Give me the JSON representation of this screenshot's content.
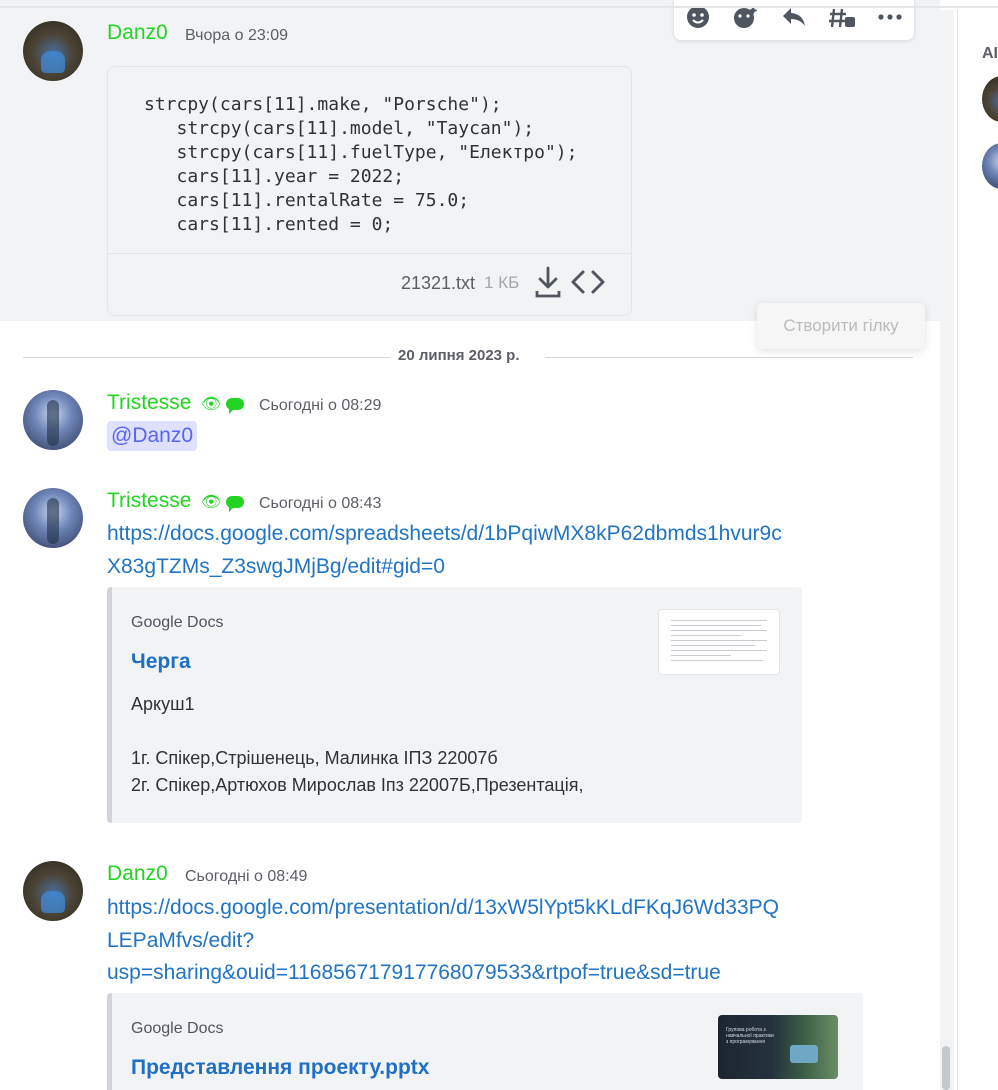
{
  "messages": [
    {
      "user": "Danz0",
      "time": "Вчора о 23:09",
      "code": "strcpy(cars[11].make, \"Porsche\");\n   strcpy(cars[11].model, \"Taycan\");\n   strcpy(cars[11].fuelType, \"Електро\");\n   cars[11].year = 2022;\n   cars[11].rentalRate = 75.0;\n   cars[11].rented = 0;",
      "file_name": "21321.txt",
      "file_size": "1 КБ"
    },
    {
      "user": "Tristesse",
      "time": "Сьогодні о 08:29",
      "mention": "@Danz0"
    },
    {
      "user": "Tristesse",
      "time": "Сьогодні о 08:43",
      "link_lines": [
        "https://docs.google.com/spreadsheets/d/1bPqiwMX8kP62dbmds1hvur9c",
        "X83gTZMs_Z3swgJMjBg/edit#gid=0"
      ],
      "embed": {
        "provider": "Google Docs",
        "title": "Черга",
        "description": [
          "Аркуш1",
          "",
          "1г. Спікер,Стрішенець, Малинка ІПЗ 22007б",
          "2г. Спікер,Артюхов Мирослав Іпз 22007Б,Презентація,"
        ]
      }
    },
    {
      "user": "Danz0",
      "time": "Сьогодні о 08:49",
      "link_lines": [
        "https://docs.google.com/presentation/d/13xW5lYpt5kKLdFKqJ6Wd33PQ",
        "LEPaMfvs/edit?",
        "usp=sharing&ouid=116856717917768079533&rtpof=true&sd=true"
      ],
      "embed": {
        "provider": "Google Docs",
        "title": "Представлення проекту.pptx",
        "thumbnail_text": "Групова робота з навчальної практики з програмування"
      }
    }
  ],
  "date_divider": "20 липня 2023 р.",
  "tooltip": "Створити гілку",
  "sidebar": {
    "label": "АІ"
  },
  "colors": {
    "username": "#23d423",
    "link": "#2174c4",
    "mention_bg": "#dee0fc",
    "highlight_bg": "#f2f3f5"
  },
  "toolbar_icons": [
    "add-reaction-icon",
    "super-reaction-icon",
    "reply-icon",
    "create-thread-icon",
    "more-icon"
  ]
}
